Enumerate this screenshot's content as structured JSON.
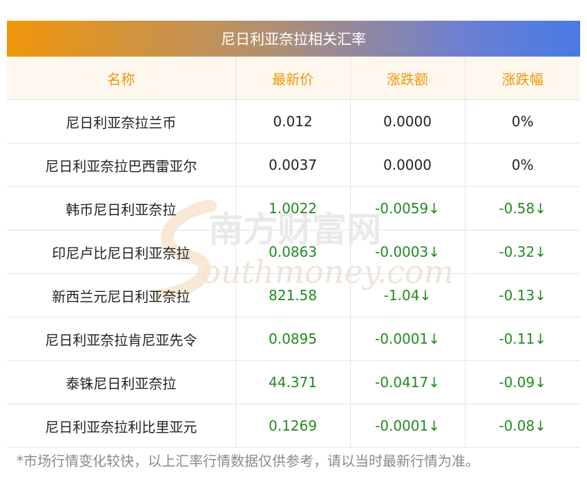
{
  "title": "尼日利亚奈拉相关汇率",
  "headers": [
    "名称",
    "最新价",
    "涨跌额",
    "涨跌幅"
  ],
  "rows": [
    {
      "name": "尼日利亚奈拉兰币",
      "price": "0.012",
      "change": "0.0000",
      "pct": "0%",
      "trend": "flat"
    },
    {
      "name": "尼日利亚奈拉巴西雷亚尔",
      "price": "0.0037",
      "change": "0.0000",
      "pct": "0%",
      "trend": "flat"
    },
    {
      "name": "韩币尼日利亚奈拉",
      "price": "1.0022",
      "change": "-0.0059↓",
      "pct": "-0.58↓",
      "trend": "down"
    },
    {
      "name": "印尼卢比尼日利亚奈拉",
      "price": "0.0863",
      "change": "-0.0003↓",
      "pct": "-0.32↓",
      "trend": "down"
    },
    {
      "name": "新西兰元尼日利亚奈拉",
      "price": "821.58",
      "change": "-1.04↓",
      "pct": "-0.13↓",
      "trend": "down"
    },
    {
      "name": "尼日利亚奈拉肯尼亚先令",
      "price": "0.0895",
      "change": "-0.0001↓",
      "pct": "-0.11↓",
      "trend": "down"
    },
    {
      "name": "泰铢尼日利亚奈拉",
      "price": "44.371",
      "change": "-0.0417↓",
      "pct": "-0.09↓",
      "trend": "down"
    },
    {
      "name": "尼日利亚奈拉利比里亚元",
      "price": "0.1269",
      "change": "-0.0001↓",
      "pct": "-0.08↓",
      "trend": "down"
    }
  ],
  "footnote": "*市场行情变化较快，以上汇率行情数据仅供参考，请以当时最新行情为准。",
  "watermark": {
    "cn": "南方财富网",
    "en": "outhmoney.com"
  },
  "colors": {
    "header_text": "#f0960a",
    "down": "#1f8a1f",
    "title_gradient_start": "#f0960a",
    "title_gradient_end": "#4a7ae6"
  }
}
